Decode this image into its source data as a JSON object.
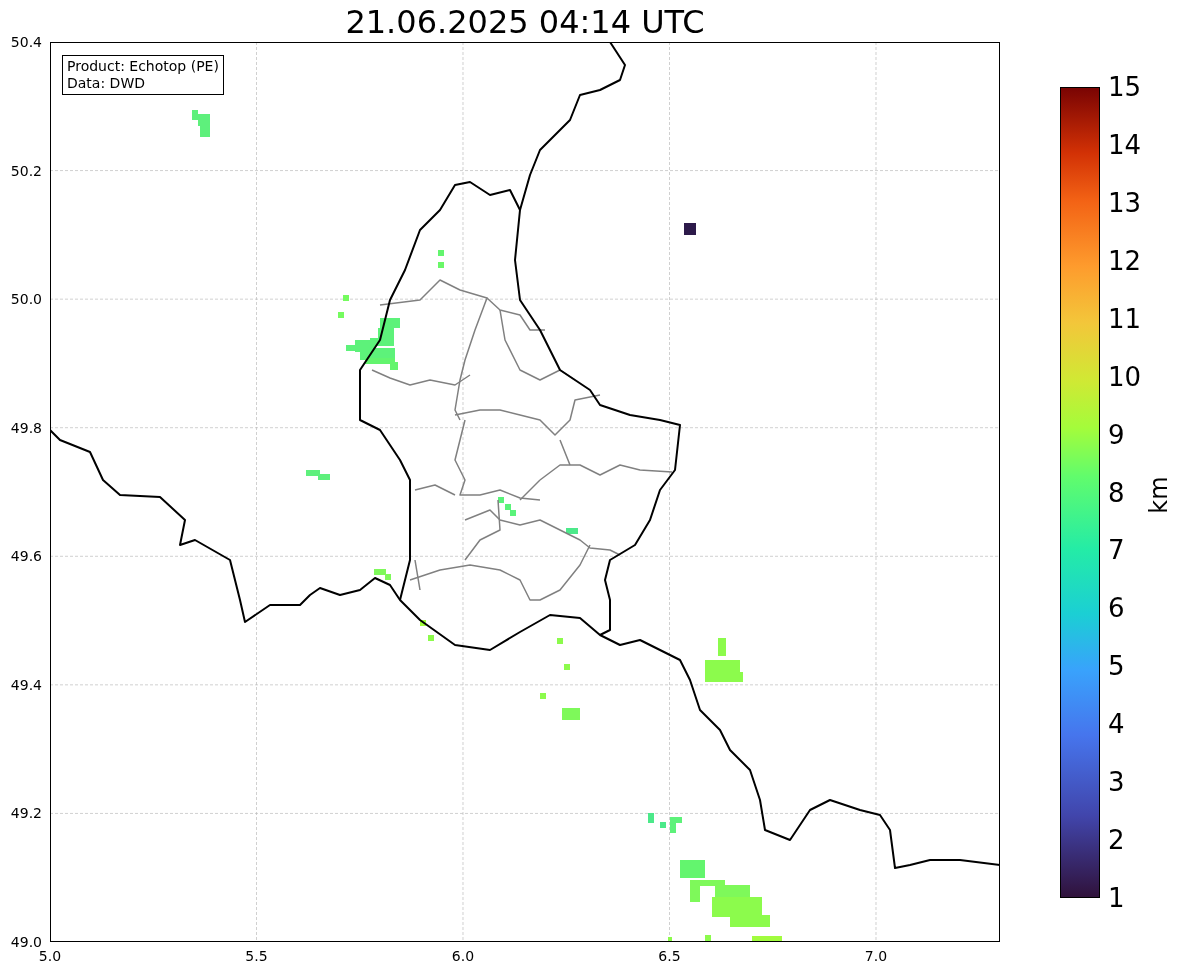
{
  "title": "21.06.2025 04:14 UTC",
  "legend": [
    "Product: Echotop (PE)",
    "Data: DWD"
  ],
  "x_ticks": [
    "5.0",
    "5.5",
    "6.0",
    "6.5",
    "7.0"
  ],
  "y_ticks": [
    "50.4",
    "50.2",
    "50.0",
    "49.8",
    "49.6",
    "49.4",
    "49.2",
    "49.0"
  ],
  "colorbar": {
    "label": "km",
    "ticks": [
      "15",
      "14",
      "13",
      "12",
      "11",
      "10",
      "9",
      "8",
      "7",
      "6",
      "5",
      "4",
      "3",
      "2",
      "1"
    ]
  }
}
